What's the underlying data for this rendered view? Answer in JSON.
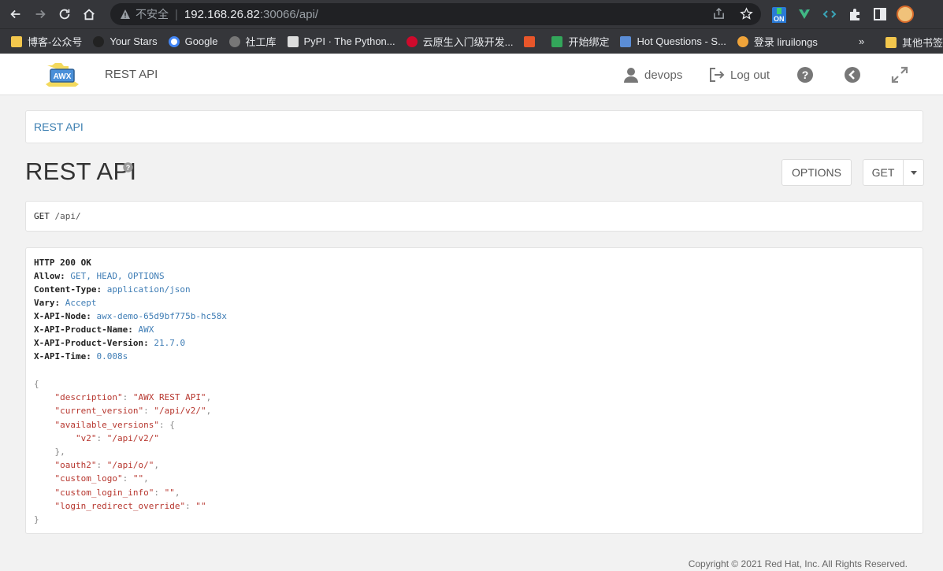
{
  "browser": {
    "security_label": "不安全",
    "url_host": "192.168.26.82",
    "url_rest": ":30066/api/",
    "ext_badge": "ON",
    "bookmarks": [
      {
        "label": "博客-公众号",
        "color": "#f3c74d"
      },
      {
        "label": "Your Stars",
        "color": "#222"
      },
      {
        "label": "Google",
        "color": "#4285f4"
      },
      {
        "label": "社工库",
        "color": "#777"
      },
      {
        "label": "PyPI · The Python...",
        "color": "#ddd"
      },
      {
        "label": "云原生入门级开发...",
        "color": "#cf0a2c"
      },
      {
        "label": "",
        "color": "#e8562a"
      },
      {
        "label": "开始绑定",
        "color": "#33a65a"
      },
      {
        "label": "Hot Questions - S...",
        "color": "#5b8dd6"
      },
      {
        "label": "登录 liruilongs",
        "color": "#f0a43a"
      }
    ],
    "bookmarks_more": "»",
    "bookmarks_other": "其他书签"
  },
  "header": {
    "logo_text": "AWX",
    "title": "REST API",
    "user": "devops",
    "logout": "Log out"
  },
  "breadcrumb": "REST API",
  "page": {
    "title": "REST API",
    "options_label": "OPTIONS",
    "get_label": "GET"
  },
  "request": {
    "method": "GET",
    "path": "/api/"
  },
  "response": {
    "status": "HTTP 200 OK",
    "headers": [
      {
        "key": "Allow:",
        "value": "GET, HEAD, OPTIONS"
      },
      {
        "key": "Content-Type:",
        "value": "application/json"
      },
      {
        "key": "Vary:",
        "value": "Accept"
      },
      {
        "key": "X-API-Node:",
        "value": "awx-demo-65d9bf775b-hc58x"
      },
      {
        "key": "X-API-Product-Name:",
        "value": "AWX"
      },
      {
        "key": "X-API-Product-Version:",
        "value": "21.7.0"
      },
      {
        "key": "X-API-Time:",
        "value": "0.008s"
      }
    ],
    "body": [
      {
        "indent": "",
        "key": "",
        "value": "",
        "punc": "{"
      },
      {
        "indent": "    ",
        "key": "\"description\"",
        "value": "\"AWX REST API\"",
        "punc": ","
      },
      {
        "indent": "    ",
        "key": "\"current_version\"",
        "value": "\"/api/v2/\"",
        "punc": ","
      },
      {
        "indent": "    ",
        "key": "\"available_versions\"",
        "value": "",
        "punc": ": {"
      },
      {
        "indent": "        ",
        "key": "\"v2\"",
        "value": "\"/api/v2/\"",
        "punc": ""
      },
      {
        "indent": "    ",
        "key": "",
        "value": "",
        "punc": "},"
      },
      {
        "indent": "    ",
        "key": "\"oauth2\"",
        "value": "\"/api/o/\"",
        "punc": ","
      },
      {
        "indent": "    ",
        "key": "\"custom_logo\"",
        "value": "\"\"",
        "punc": ","
      },
      {
        "indent": "    ",
        "key": "\"custom_login_info\"",
        "value": "\"\"",
        "punc": ","
      },
      {
        "indent": "    ",
        "key": "\"login_redirect_override\"",
        "value": "\"\"",
        "punc": ""
      },
      {
        "indent": "",
        "key": "",
        "value": "",
        "punc": "}"
      }
    ]
  },
  "footer": "Copyright © 2021 Red Hat, Inc. All Rights Reserved.",
  "icons": {
    "back": "arrow-left-icon",
    "forward": "arrow-right-icon",
    "reload": "reload-icon",
    "home": "home-icon",
    "user": "user-icon",
    "logout": "logout-icon",
    "help": "question-circle-icon",
    "api_back": "arrow-circle-left-icon",
    "expand": "expand-icon"
  },
  "colors": {
    "link": "#3c7fb1",
    "chrome": "#35363a",
    "json_red": "#b7372f"
  }
}
